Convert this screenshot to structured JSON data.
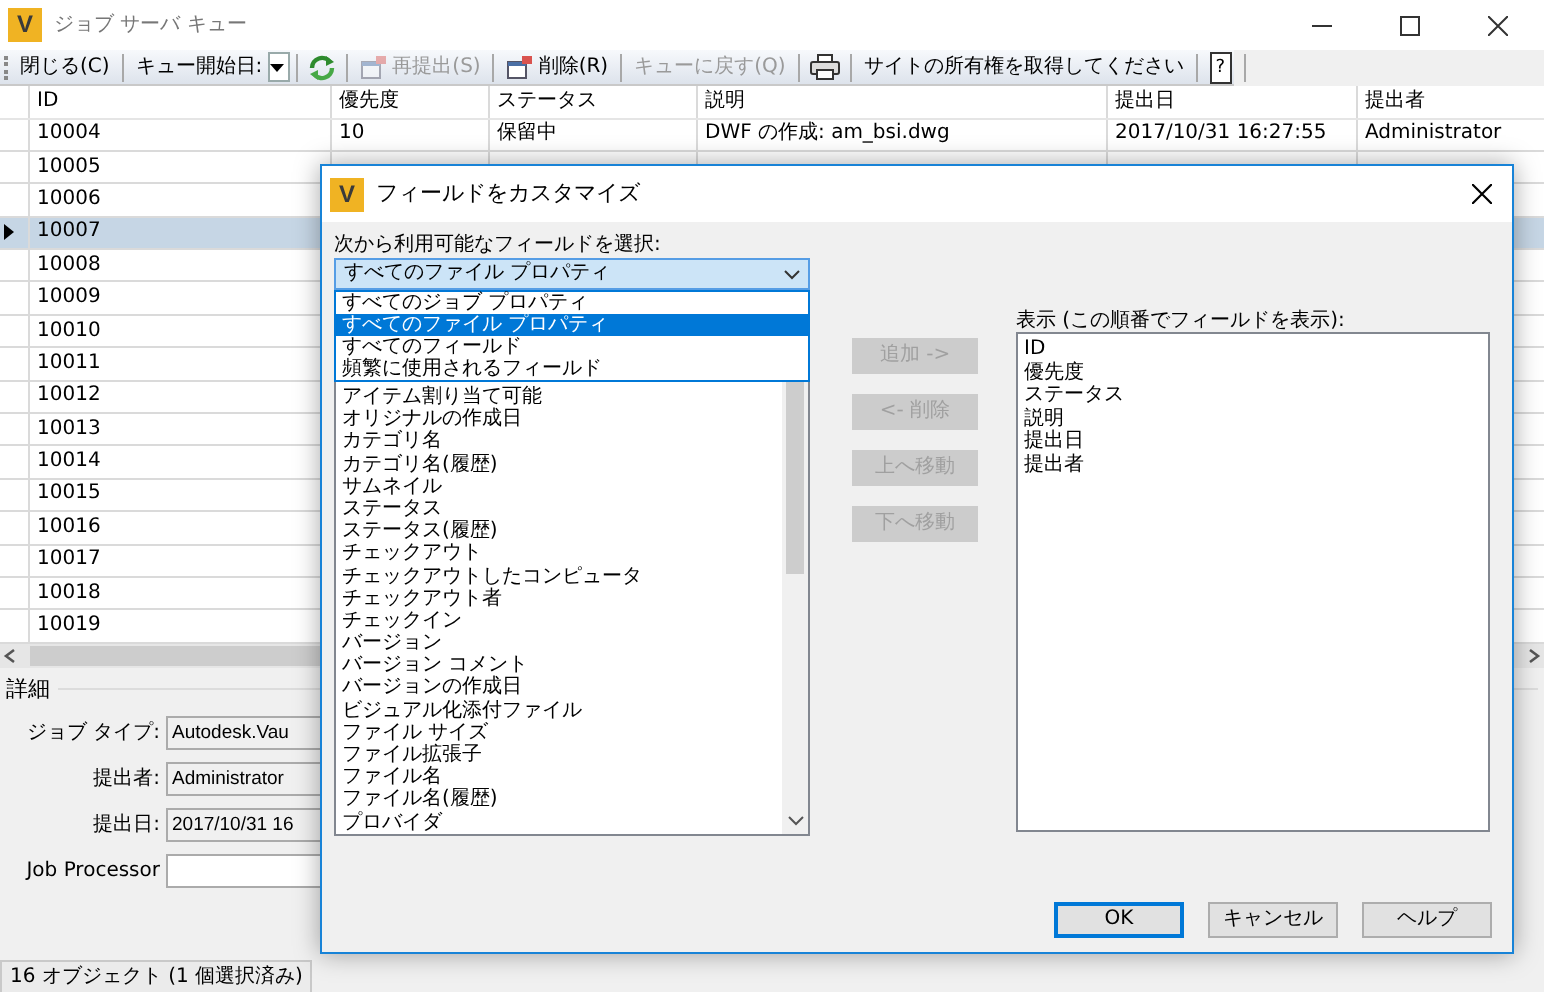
{
  "window": {
    "logo": "V",
    "title": "ジョブ サーバ キュー"
  },
  "toolbar": [
    {
      "kind": "button",
      "label": "閉じる(C)",
      "disabled": false
    },
    {
      "kind": "label",
      "label": "キュー開始日:"
    },
    {
      "kind": "combo"
    },
    {
      "kind": "refresh"
    },
    {
      "kind": "icon-button",
      "label": "再提出(S)",
      "disabled": true
    },
    {
      "kind": "icon-button",
      "label": "削除(R)",
      "disabled": false
    },
    {
      "kind": "button",
      "label": "キューに戻す(Q)",
      "disabled": true
    },
    {
      "kind": "print"
    },
    {
      "kind": "button",
      "label": "サイトの所有権を取得してください",
      "disabled": false
    },
    {
      "kind": "help",
      "label": "?",
      "disabled": false
    }
  ],
  "table": {
    "columns": [
      "ID",
      "優先度",
      "ステータス",
      "説明",
      "提出日",
      "提出者"
    ],
    "rows": [
      {
        "cells": [
          "10004",
          "10",
          "保留中",
          "DWF の作成: am_bsi.dwg",
          "2017/10/31 16:27:55",
          "Administrator"
        ],
        "selected": false
      },
      {
        "cells": [
          "10005"
        ],
        "selected": false
      },
      {
        "cells": [
          "10006"
        ],
        "selected": false
      },
      {
        "cells": [
          "10007"
        ],
        "selected": true
      },
      {
        "cells": [
          "10008"
        ],
        "selected": false
      },
      {
        "cells": [
          "10009"
        ],
        "selected": false
      },
      {
        "cells": [
          "10010"
        ],
        "selected": false
      },
      {
        "cells": [
          "10011"
        ],
        "selected": false
      },
      {
        "cells": [
          "10012"
        ],
        "selected": false
      },
      {
        "cells": [
          "10013"
        ],
        "selected": false
      },
      {
        "cells": [
          "10014"
        ],
        "selected": false
      },
      {
        "cells": [
          "10015"
        ],
        "selected": false
      },
      {
        "cells": [
          "10016"
        ],
        "selected": false
      },
      {
        "cells": [
          "10017"
        ],
        "selected": false
      },
      {
        "cells": [
          "10018"
        ],
        "selected": false
      },
      {
        "cells": [
          "10019"
        ],
        "selected": false
      }
    ]
  },
  "details": {
    "title": "詳細",
    "fields": [
      {
        "label": "ジョブ タイプ:",
        "value": "Autodesk.Vau"
      },
      {
        "label": "提出者:",
        "value": "Administrator"
      },
      {
        "label": "提出日:",
        "value": "2017/10/31 16"
      },
      {
        "label": "Job Processor"
      }
    ]
  },
  "status_bar": "16 オブジェクト (1 個選択済み)",
  "dialog": {
    "logo": "V",
    "title": "フィールドをカスタマイズ",
    "available_label": "次から利用可能なフィールドを選択:",
    "combo_value": "すべてのファイル プロパティ",
    "dropdown_options": [
      {
        "label": "すべてのジョブ プロパティ",
        "selected": false
      },
      {
        "label": "すべてのファイル プロパティ",
        "selected": true
      },
      {
        "label": "すべてのフィールド",
        "selected": false
      },
      {
        "label": "頻繁に使用されるフィールド",
        "selected": false
      }
    ],
    "available_fields": [
      "アイテム割り当て可能",
      "オリジナルの作成日",
      "カテゴリ名",
      "カテゴリ名(履歴)",
      "サムネイル",
      "ステータス",
      "ステータス(履歴)",
      "チェックアウト",
      "チェックアウトしたコンピュータ",
      "チェックアウト者",
      "チェックイン",
      "バージョン",
      "バージョン コメント",
      "バージョンの作成日",
      "ビジュアル化添付ファイル",
      "ファイル サイズ",
      "ファイル拡張子",
      "ファイル名",
      "ファイル名(履歴)",
      "プロバイダ"
    ],
    "move_buttons": [
      {
        "label": "追加 ->",
        "disabled": true
      },
      {
        "label": "<- 削除",
        "disabled": true
      },
      {
        "label": "上へ移動",
        "disabled": true
      },
      {
        "label": "下へ移動",
        "disabled": true
      }
    ],
    "shown_label": "表示 (この順番でフィールドを表示):",
    "shown_fields": [
      "ID",
      "優先度",
      "ステータス",
      "説明",
      "提出日",
      "提出者"
    ],
    "buttons": [
      {
        "label": "OK",
        "default": true
      },
      {
        "label": "キャンセル",
        "default": false
      },
      {
        "label": "ヘルプ",
        "default": false
      }
    ]
  }
}
